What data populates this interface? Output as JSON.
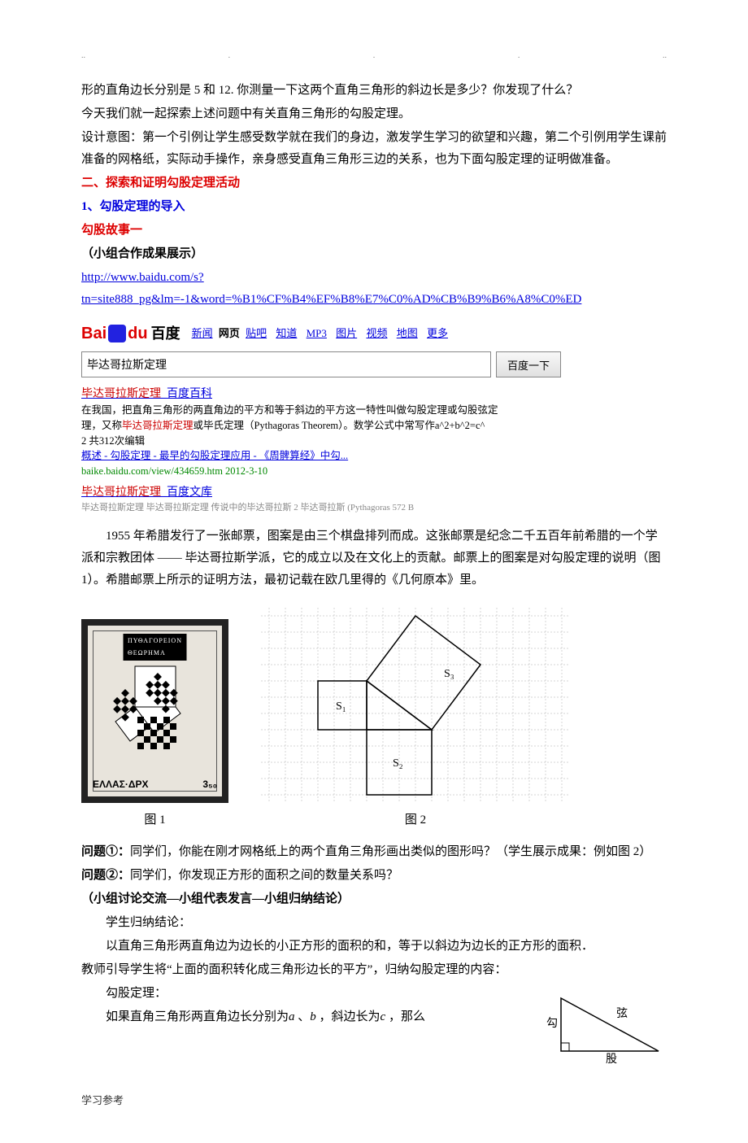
{
  "header": {
    "d1": "..",
    "d2": ".",
    "d3": ".",
    "d4": ".",
    "d5": ".."
  },
  "intro": {
    "p1": "形的直角边长分别是 5 和 12. 你测量一下这两个直角三角形的斜边长是多少？你发现了什么？",
    "p2": "今天我们就一起探索上述问题中有关直角三角形的勾股定理。",
    "p3": "设计意图：第一个引例让学生感受数学就在我们的身边，激发学生学习的欲望和兴趣，第二个引例用学生课前准备的网格纸，实际动手操作，亲身感受直角三角形三边的关系，也为下面勾股定理的证明做准备。"
  },
  "section2": {
    "title": "二、探索和证明勾股定理活动",
    "sub1": "1、勾股定理的导入",
    "story": "勾股故事一",
    "group": "（小组合作成果展示）",
    "url": "http://www.baidu.com/s?tn=site888_pg&lm=-1&word=%B1%CF%B4%EF%B8%E7%C0%AD%CB%B9%B6%A8%C0%ED"
  },
  "baidu": {
    "logo_bai": "Bai",
    "logo_du": "du",
    "logo_hanzi": "百度",
    "nav": {
      "news": "新闻",
      "web": "网页",
      "tieba": "贴吧",
      "zhidao": "知道",
      "mp3": "MP3",
      "image": "图片",
      "video": "视频",
      "map": "地图",
      "more": "更多"
    },
    "search_value": "毕达哥拉斯定理",
    "search_btn": "百度一下",
    "r1": {
      "title_pre": "毕达哥拉斯定理",
      "title_suf": "_百度百科",
      "line1": "在我国，把直角三角形的两直角边的平方和等于斜边的平方这一特性叫做勾股定理或勾股弦定",
      "line2_a": "理，又称",
      "line2_b": "毕达哥拉斯定理",
      "line2_c": "或毕氏定理（Pythagoras Theorem）。数学公式中常写作a^2+b^2=c^",
      "line3": "2 共312次编辑",
      "links": "概述 - 勾股定理 - 最早的勾股定理应用 - 《周髀算经》中勾...",
      "green": "baike.baidu.com/view/434659.htm 2012-3-10"
    },
    "r2": {
      "title_pre": "毕达哥拉斯定理",
      "title_suf": "_百度文库",
      "cut": "毕达哥拉斯定理  毕达哥拉斯定理  传说中的毕达哥拉斯 2 毕达哥拉斯 (Pythagoras 572 B"
    }
  },
  "body": {
    "p1": "1955 年希腊发行了一张邮票，图案是由三个棋盘排列而成。这张邮票是纪念二千五百年前希腊的一个学派和宗教团体 —— 毕达哥拉斯学派，它的成立以及在文化上的贡献。邮票上的图案是对勾股定理的说明（图 1）。希腊邮票上所示的证明方法，最初记载在欧几里得的《几何原本》里。"
  },
  "stamp": {
    "title": "ΠΥΘΑΓΟΡΕΙΟΝ",
    "sub": "ΘΕΩΡΗΜΑ",
    "bottom_l": "ΕΛΛΑΣ·ΔΡΧ",
    "bottom_r": "3₅₀"
  },
  "diagram": {
    "s1": "S₁",
    "s2": "S₂",
    "s3": "S₃"
  },
  "captions": {
    "fig1": "图 1",
    "fig2": "图 2"
  },
  "questions": {
    "q1_label": "问题①：",
    "q1": "同学们，你能在刚才网格纸上的两个直角三角形画出类似的图形吗？（学生展示成果：例如图 2）",
    "q2_label": "问题②：",
    "q2": "同学们，你发现正方形的面积之间的数量关系吗？",
    "group": "（小组讨论交流—小组代表发言—小组归纳结论）",
    "concl_label": "学生归纳结论：",
    "concl": "以直角三角形两直角边为边长的小正方形的面积的和，等于以斜边为边长的正方形的面积．",
    "teacher": "教师引导学生将“上面的面积转化成三角形边长的平方”，归纳勾股定理的内容：",
    "theorem_label": "勾股定理：",
    "theorem_a": "如果直角三角形两直角边长分别为",
    "a": "a",
    "b": "b",
    "c": "c",
    "theorem_b": "、",
    "theorem_c": "，斜边长为",
    "theorem_d": "，那么"
  },
  "tri": {
    "gou": "勾",
    "xian": "弦",
    "gu": "股"
  },
  "footer": "学习参考"
}
